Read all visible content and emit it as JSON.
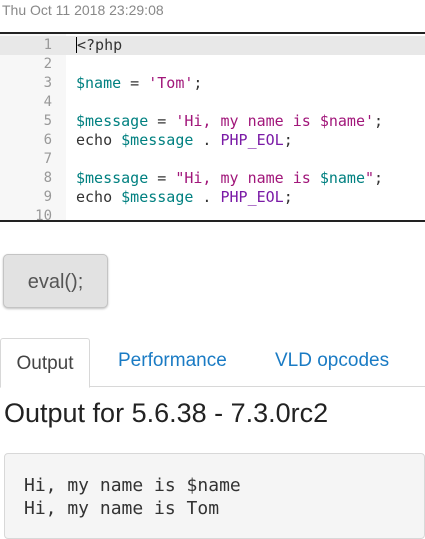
{
  "timestamp": "Thu Oct 11 2018 23:29:08",
  "editor": {
    "lines": [
      {
        "n": "1",
        "tokens": [
          {
            "t": "<?php",
            "c": "plain"
          }
        ]
      },
      {
        "n": "2",
        "tokens": []
      },
      {
        "n": "3",
        "tokens": [
          {
            "t": "$name",
            "c": "var"
          },
          {
            "t": " = ",
            "c": "plain"
          },
          {
            "t": "'Tom'",
            "c": "str"
          },
          {
            "t": ";",
            "c": "plain"
          }
        ]
      },
      {
        "n": "4",
        "tokens": []
      },
      {
        "n": "5",
        "tokens": [
          {
            "t": "$message",
            "c": "var"
          },
          {
            "t": " = ",
            "c": "plain"
          },
          {
            "t": "'Hi, my name is $name'",
            "c": "str"
          },
          {
            "t": ";",
            "c": "plain"
          }
        ]
      },
      {
        "n": "6",
        "tokens": [
          {
            "t": "echo ",
            "c": "plain"
          },
          {
            "t": "$message",
            "c": "var"
          },
          {
            "t": " . ",
            "c": "plain"
          },
          {
            "t": "PHP_EOL",
            "c": "const"
          },
          {
            "t": ";",
            "c": "plain"
          }
        ]
      },
      {
        "n": "7",
        "tokens": []
      },
      {
        "n": "8",
        "tokens": [
          {
            "t": "$message",
            "c": "var"
          },
          {
            "t": " = ",
            "c": "plain"
          },
          {
            "t": "\"Hi, my name is ",
            "c": "str"
          },
          {
            "t": "$name",
            "c": "var"
          },
          {
            "t": "\"",
            "c": "str"
          },
          {
            "t": ";",
            "c": "plain"
          }
        ]
      },
      {
        "n": "9",
        "tokens": [
          {
            "t": "echo ",
            "c": "plain"
          },
          {
            "t": "$message",
            "c": "var"
          },
          {
            "t": " . ",
            "c": "plain"
          },
          {
            "t": "PHP_EOL",
            "c": "const"
          },
          {
            "t": ";",
            "c": "plain"
          }
        ]
      },
      {
        "n": "10",
        "tokens": []
      }
    ]
  },
  "eval_button_label": "eval();",
  "tabs": [
    {
      "label": "Output",
      "active": true
    },
    {
      "label": "Performance",
      "active": false
    },
    {
      "label": "VLD opcodes",
      "active": false
    }
  ],
  "output": {
    "heading": "Output for 5.6.38 - 7.3.0rc2",
    "text": "Hi, my name is $name\nHi, my name is Tom"
  }
}
